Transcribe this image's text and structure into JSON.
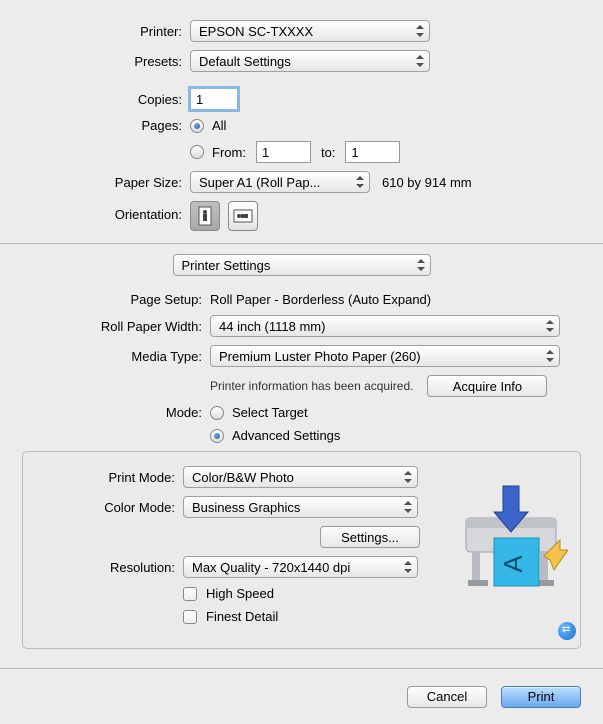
{
  "printer": {
    "label": "Printer:",
    "value": "EPSON SC-TXXXX"
  },
  "presets": {
    "label": "Presets:",
    "value": "Default Settings"
  },
  "copies": {
    "label": "Copies:",
    "value": "1"
  },
  "pages": {
    "label": "Pages:",
    "all": "All",
    "from_label": "From:",
    "from_value": "1",
    "to_label": "to:",
    "to_value": "1"
  },
  "paper_size": {
    "label": "Paper Size:",
    "value": "Super A1 (Roll Pap...",
    "dims": "610 by 914 mm"
  },
  "orientation": {
    "label": "Orientation:"
  },
  "section_select": "Printer Settings",
  "page_setup": {
    "label": "Page Setup:",
    "value": "Roll Paper - Borderless (Auto Expand)"
  },
  "roll_width": {
    "label": "Roll Paper Width:",
    "value": "44 inch (1118 mm)"
  },
  "media_type": {
    "label": "Media Type:",
    "value": "Premium Luster Photo Paper (260)"
  },
  "acquire": {
    "info": "Printer information has been acquired.",
    "button": "Acquire Info"
  },
  "mode": {
    "label": "Mode:",
    "opt1": "Select Target",
    "opt2": "Advanced Settings"
  },
  "print_mode": {
    "label": "Print Mode:",
    "value": "Color/B&W Photo"
  },
  "color_mode": {
    "label": "Color Mode:",
    "value": "Business Graphics",
    "settings_btn": "Settings..."
  },
  "resolution": {
    "label": "Resolution:",
    "value": "Max Quality - 720x1440 dpi"
  },
  "check_high_speed": "High Speed",
  "check_finest": "Finest Detail",
  "footer": {
    "cancel": "Cancel",
    "print": "Print"
  }
}
